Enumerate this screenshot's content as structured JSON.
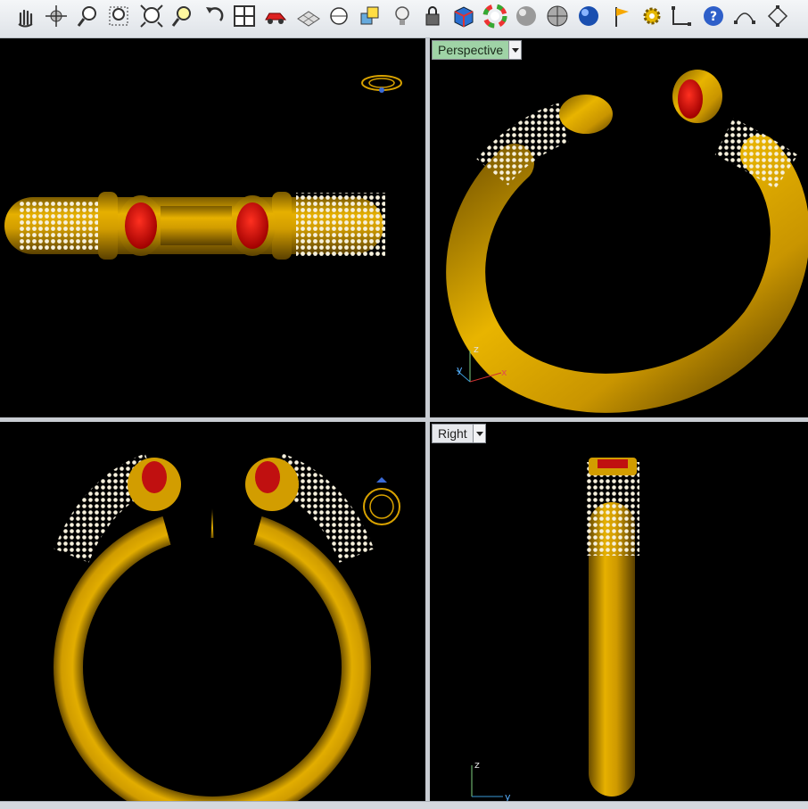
{
  "toolbar": {
    "buttons": [
      {
        "name": "pan-hand-icon"
      },
      {
        "name": "rotate-view-icon"
      },
      {
        "name": "zoom-dynamic-icon"
      },
      {
        "name": "zoom-window-icon"
      },
      {
        "name": "zoom-extents-icon"
      },
      {
        "name": "zoom-selected-icon"
      },
      {
        "name": "undo-view-icon"
      },
      {
        "name": "four-viewports-icon"
      },
      {
        "name": "car-icon"
      },
      {
        "name": "grid-plane-icon"
      },
      {
        "name": "snap-icon"
      },
      {
        "name": "layer-icon"
      },
      {
        "name": "light-bulb-icon"
      },
      {
        "name": "lock-icon"
      },
      {
        "name": "shaded-box-icon"
      },
      {
        "name": "color-wheel-icon"
      },
      {
        "name": "sphere-gray-icon"
      },
      {
        "name": "sphere-grid-icon"
      },
      {
        "name": "sphere-blue-icon"
      },
      {
        "name": "flag-icon"
      },
      {
        "name": "gear-icon"
      },
      {
        "name": "point-editing-icon"
      },
      {
        "name": "help-icon"
      },
      {
        "name": "curve-points-icon"
      },
      {
        "name": "control-points-icon"
      }
    ]
  },
  "viewports": {
    "perspective": {
      "label": "Perspective"
    },
    "right": {
      "label": "Right"
    }
  },
  "axes": {
    "x": "x",
    "y": "y",
    "z": "z"
  },
  "colors": {
    "gold": "#d8a200",
    "ruby": "#d01010",
    "background": "#000000",
    "active_label": "#9fd3a6"
  }
}
